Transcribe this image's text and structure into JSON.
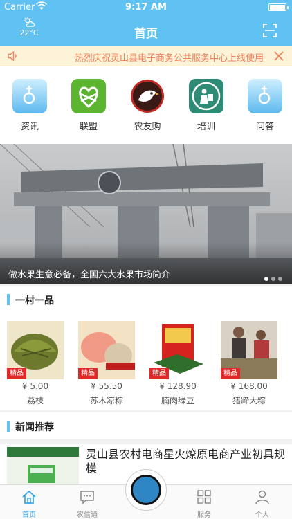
{
  "status_bar": {
    "carrier": "Carrier",
    "time": "9:17 AM"
  },
  "header": {
    "temperature": "22°C",
    "title": "首页",
    "weather_icon": "weather-icon",
    "scan_icon": "scan-icon"
  },
  "notice": {
    "text": "热烈庆祝灵山县电子商务公共服务中心上线使用"
  },
  "menu": [
    {
      "label": "资讯",
      "icon": "info-icon"
    },
    {
      "label": "联盟",
      "icon": "alliance-icon"
    },
    {
      "label": "农友购",
      "icon": "shop-icon"
    },
    {
      "label": "培训",
      "icon": "training-icon"
    },
    {
      "label": "问答",
      "icon": "qa-icon"
    }
  ],
  "banner": {
    "caption": "做水果生意必备，全国六大水果市场简介",
    "slide_count": 3,
    "active_slide": 1
  },
  "featured": {
    "title": "一村一品",
    "items": [
      {
        "tag": "精品",
        "price": "¥ 5.00",
        "name": "荔枝"
      },
      {
        "tag": "精品",
        "price": "¥ 55.50",
        "name": "苏木凉粽"
      },
      {
        "tag": "精品",
        "price": "¥ 128.90",
        "name": "腩肉绿豆"
      },
      {
        "tag": "精品",
        "price": "¥ 168.00",
        "name": "猪蹄大粽"
      }
    ]
  },
  "news": {
    "title": "新闻推荐",
    "items": [
      {
        "title": "灵山县农村电商星火燎原电商产业初具规模"
      }
    ]
  },
  "tabbar": [
    {
      "label": "首页",
      "icon": "home-icon",
      "active": true
    },
    {
      "label": "农信通",
      "icon": "message-icon",
      "active": false
    },
    {
      "label": "服务",
      "icon": "grid-icon",
      "active": false
    },
    {
      "label": "个人",
      "icon": "user-icon",
      "active": false
    }
  ],
  "colors": {
    "primary": "#5fc2f3",
    "notice_text": "#f4815a",
    "tag_red": "#e02a2a",
    "tab_active": "#2aa0ea"
  }
}
